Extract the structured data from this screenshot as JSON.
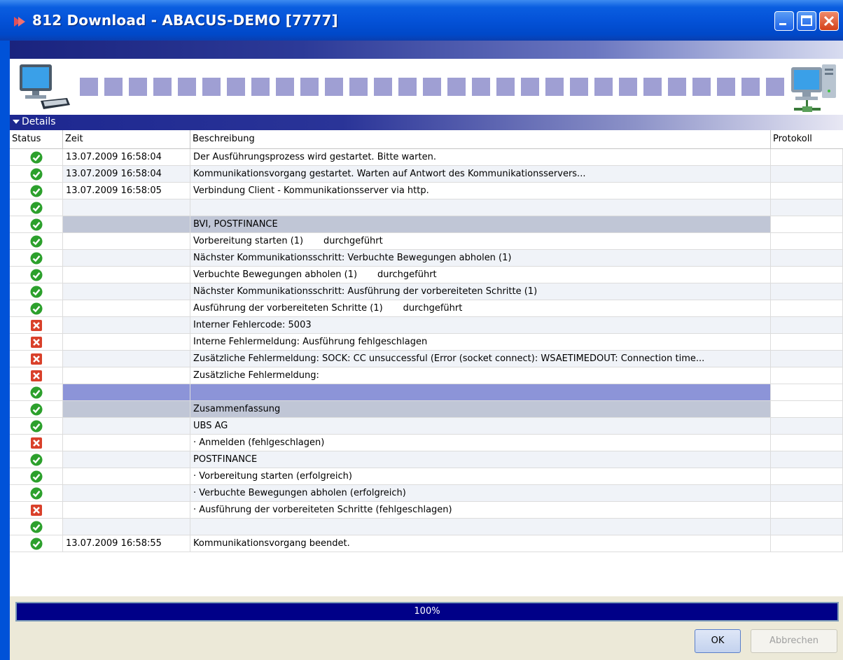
{
  "window": {
    "title": "812 Download - ABACUS-DEMO [7777]",
    "icons": [
      "app-icon",
      "minimize-icon",
      "maximize-icon",
      "close-icon"
    ]
  },
  "details": {
    "label": "Details",
    "icon": "triangle-down-icon"
  },
  "table": {
    "columns": [
      "Status",
      "Zeit",
      "Beschreibung",
      "Protokoll"
    ],
    "rows": [
      {
        "status": "ok",
        "time": "13.07.2009 16:58:04",
        "desc": "Der Ausführungsprozess wird gestartet. Bitte warten.",
        "style": ""
      },
      {
        "status": "ok",
        "time": "13.07.2009 16:58:04",
        "desc": "Kommunikationsvorgang gestartet. Warten auf Antwort des Kommunikationsservers...",
        "style": "alt"
      },
      {
        "status": "ok",
        "time": "13.07.2009 16:58:05",
        "desc": "Verbindung Client - Kommunikationsserver via http.",
        "style": ""
      },
      {
        "status": "ok",
        "time": "",
        "desc": "",
        "style": "alt"
      },
      {
        "status": "ok",
        "time": "",
        "desc": "BVI, POSTFINANCE",
        "style": "hl-gray"
      },
      {
        "status": "ok",
        "time": "",
        "desc": "Vorbereitung starten (1)       durchgeführt",
        "style": ""
      },
      {
        "status": "ok",
        "time": "",
        "desc": "Nächster Kommunikationsschritt: Verbuchte Bewegungen abholen (1)",
        "style": "alt"
      },
      {
        "status": "ok",
        "time": "",
        "desc": "Verbuchte Bewegungen abholen (1)       durchgeführt",
        "style": ""
      },
      {
        "status": "ok",
        "time": "",
        "desc": "Nächster Kommunikationsschritt: Ausführung der vorbereiteten Schritte (1)",
        "style": "alt"
      },
      {
        "status": "ok",
        "time": "",
        "desc": "Ausführung der vorbereiteten Schritte (1)       durchgeführt",
        "style": ""
      },
      {
        "status": "error",
        "time": "",
        "desc": "Interner Fehlercode: 5003",
        "style": "alt"
      },
      {
        "status": "error",
        "time": "",
        "desc": "Interne Fehlermeldung: Ausführung fehlgeschlagen",
        "style": ""
      },
      {
        "status": "error",
        "time": "",
        "desc": "Zusätzliche Fehlermeldung: SOCK: CC unsuccessful (Error (socket connect): WSAETIMEDOUT: Connection time...",
        "style": "alt"
      },
      {
        "status": "error",
        "time": "",
        "desc": "Zusätzliche Fehlermeldung:",
        "style": ""
      },
      {
        "status": "ok",
        "time": "",
        "desc": "",
        "style": "hl-blue"
      },
      {
        "status": "ok",
        "time": "",
        "desc": "Zusammenfassung",
        "style": "hl-gray"
      },
      {
        "status": "ok",
        "time": "",
        "desc": "UBS AG",
        "style": "alt"
      },
      {
        "status": "error",
        "time": "",
        "desc": "· Anmelden (fehlgeschlagen)",
        "style": ""
      },
      {
        "status": "ok",
        "time": "",
        "desc": "POSTFINANCE",
        "style": "alt"
      },
      {
        "status": "ok",
        "time": "",
        "desc": "· Vorbereitung starten (erfolgreich)",
        "style": ""
      },
      {
        "status": "ok",
        "time": "",
        "desc": "· Verbuchte Bewegungen abholen (erfolgreich)",
        "style": "alt"
      },
      {
        "status": "error",
        "time": "",
        "desc": "· Ausführung der vorbereiteten Schritte (fehlgeschlagen)",
        "style": ""
      },
      {
        "status": "ok",
        "time": "",
        "desc": "",
        "style": "alt"
      },
      {
        "status": "ok",
        "time": "13.07.2009 16:58:55",
        "desc": "Kommunikationsvorgang beendet.",
        "style": ""
      }
    ]
  },
  "progress": {
    "value": 1.0,
    "label": "100%"
  },
  "buttons": {
    "ok": "OK",
    "cancel": "Abbrechen"
  },
  "colors": {
    "ok_status": "#2ca02c",
    "error_status": "#d9402a",
    "title_blue": "#0452d8"
  }
}
